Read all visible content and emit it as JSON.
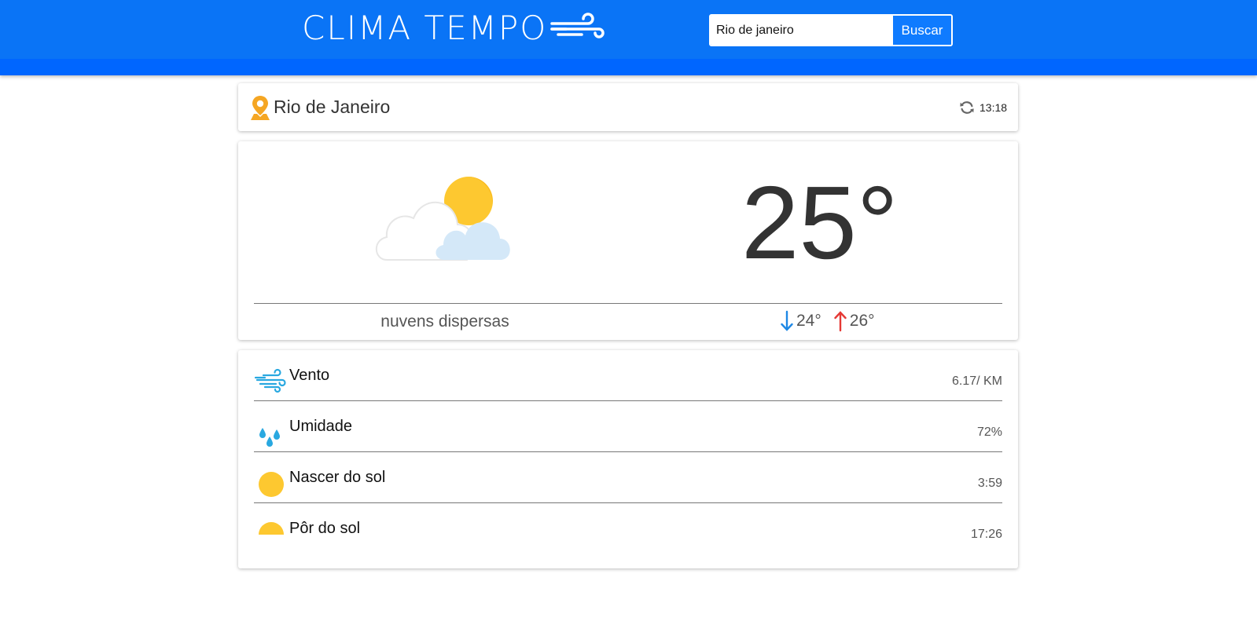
{
  "header": {
    "logo_text": "CLIMA TEMPO",
    "colors": {
      "primary": "#0a74f6",
      "accent_bar": "#0066ff"
    }
  },
  "search": {
    "value": "Rio de janeiro",
    "button_label": "Buscar"
  },
  "location": {
    "city": "Rio de Janeiro",
    "updated_time": "13:18",
    "pin_icon": "location-pin-icon",
    "refresh_icon": "refresh-icon"
  },
  "current": {
    "temperature": "25°",
    "description": "nuvens dispersas",
    "min": "24°",
    "max": "26°",
    "condition_icon": "partly-cloudy-icon",
    "min_color": "#1e88e5",
    "max_color": "#e53935"
  },
  "details": [
    {
      "label": "Vento",
      "value": "6.17/ KM",
      "icon": "wind-icon"
    },
    {
      "label": "Umidade",
      "value": "72%",
      "icon": "raindrops-icon"
    },
    {
      "label": "Nascer do sol",
      "value": "3:59",
      "icon": "sunrise-icon"
    },
    {
      "label": "Pôr do sol",
      "value": "17:26",
      "icon": "sunset-icon"
    }
  ]
}
